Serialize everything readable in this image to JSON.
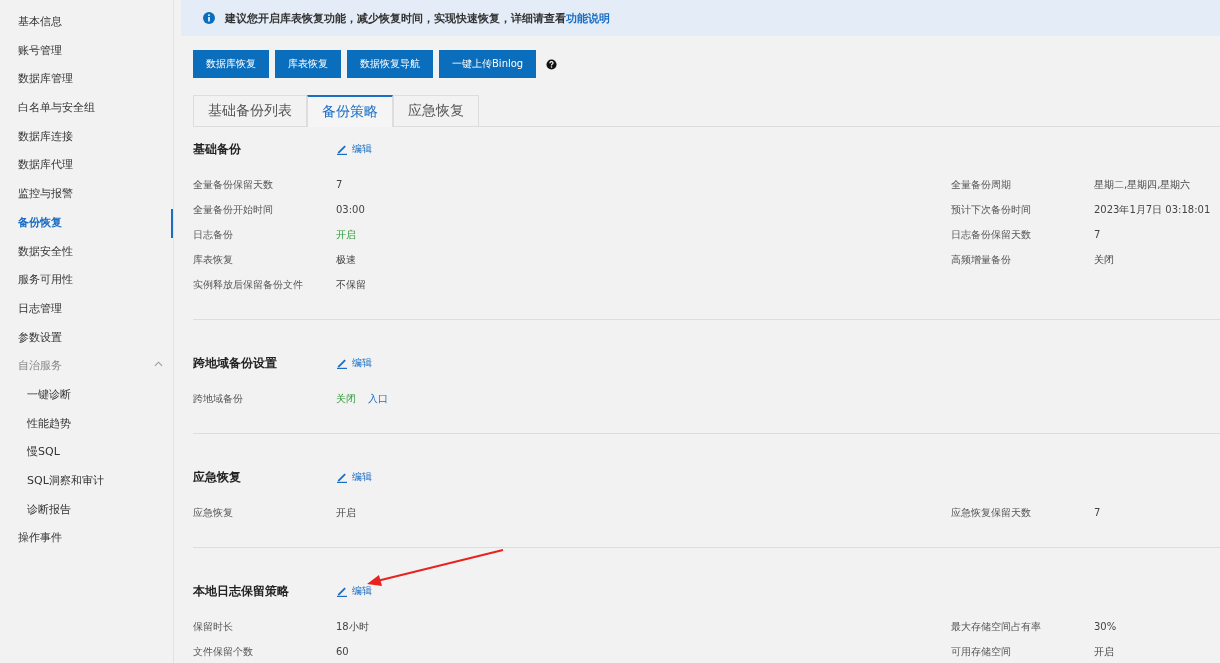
{
  "sidebar": {
    "items": [
      {
        "label": "基本信息",
        "selected": false
      },
      {
        "label": "账号管理",
        "selected": false
      },
      {
        "label": "数据库管理",
        "selected": false
      },
      {
        "label": "白名单与安全组",
        "selected": false
      },
      {
        "label": "数据库连接",
        "selected": false
      },
      {
        "label": "数据库代理",
        "selected": false
      },
      {
        "label": "监控与报警",
        "selected": false
      },
      {
        "label": "备份恢复",
        "selected": true
      },
      {
        "label": "数据安全性",
        "selected": false
      },
      {
        "label": "服务可用性",
        "selected": false
      },
      {
        "label": "日志管理",
        "selected": false
      },
      {
        "label": "参数设置",
        "selected": false
      },
      {
        "label": "自治服务",
        "selected": false,
        "expanded": true,
        "children": [
          {
            "label": "一键诊断",
            "selected": false
          },
          {
            "label": "性能趋势",
            "selected": false
          },
          {
            "label": "慢SQL",
            "selected": false
          },
          {
            "label": "SQL洞察和审计",
            "selected": false
          },
          {
            "label": "诊断报告",
            "selected": false
          }
        ]
      },
      {
        "label": "操作事件",
        "selected": false
      }
    ]
  },
  "notice": {
    "text": "建议您开启库表恢复功能，减少恢复时间，实现快速恢复，详细请查看",
    "link": "功能说明"
  },
  "buttons": [
    "数据库恢复",
    "库表恢复",
    "数据恢复导航",
    "一键上传Binlog"
  ],
  "tabs": [
    {
      "label": "基础备份列表",
      "selected": false
    },
    {
      "label": "备份策略",
      "selected": true
    },
    {
      "label": "应急恢复",
      "selected": false
    }
  ],
  "sections": [
    {
      "title": "基础备份",
      "edit": "编辑",
      "left": [
        {
          "label": "全量备份保留天数",
          "values": [
            {
              "text": "7",
              "kind": "plain"
            }
          ]
        },
        {
          "label": "全量备份开始时间",
          "values": [
            {
              "text": "03:00",
              "kind": "plain"
            }
          ]
        },
        {
          "label": "日志备份",
          "values": [
            {
              "text": "开启",
              "kind": "status"
            }
          ]
        },
        {
          "label": "库表恢复",
          "values": [
            {
              "text": "极速",
              "kind": "plain"
            }
          ]
        },
        {
          "label": "实例释放后保留备份文件",
          "values": [
            {
              "text": "不保留",
              "kind": "plain"
            }
          ]
        }
      ],
      "right": [
        {
          "label": "全量备份周期",
          "values": [
            {
              "text": "星期二,星期四,星期六",
              "kind": "plain"
            }
          ]
        },
        {
          "label": "预计下次备份时间",
          "values": [
            {
              "text": "2023年1月7日 03:18:01",
              "kind": "plain"
            }
          ]
        },
        {
          "label": "日志备份保留天数",
          "values": [
            {
              "text": "7",
              "kind": "plain"
            }
          ]
        },
        {
          "label": "高频增量备份",
          "values": [
            {
              "text": "关闭",
              "kind": "plain"
            }
          ]
        }
      ]
    },
    {
      "title": "跨地域备份设置",
      "edit": "编辑",
      "left": [
        {
          "label": "跨地域备份",
          "values": [
            {
              "text": "关闭",
              "kind": "status"
            },
            {
              "text": "入口",
              "kind": "link"
            }
          ]
        }
      ]
    },
    {
      "title": "应急恢复",
      "edit": "编辑",
      "left": [
        {
          "label": "应急恢复",
          "values": [
            {
              "text": "开启",
              "kind": "plain"
            }
          ]
        }
      ],
      "right": [
        {
          "label": "应急恢复保留天数",
          "values": [
            {
              "text": "7",
              "kind": "plain"
            }
          ]
        }
      ]
    },
    {
      "title": "本地日志保留策略",
      "edit": "编辑",
      "left": [
        {
          "label": "保留时长",
          "values": [
            {
              "text": "18小时",
              "kind": "plain"
            }
          ]
        },
        {
          "label": "文件保留个数",
          "values": [
            {
              "text": "60",
              "kind": "plain"
            }
          ]
        }
      ],
      "right": [
        {
          "label": "最大存储空间占有率",
          "values": [
            {
              "text": "30%",
              "kind": "plain"
            }
          ]
        },
        {
          "label": "可用存储空间",
          "values": [
            {
              "text": "开启",
              "kind": "plain"
            }
          ]
        }
      ]
    }
  ]
}
